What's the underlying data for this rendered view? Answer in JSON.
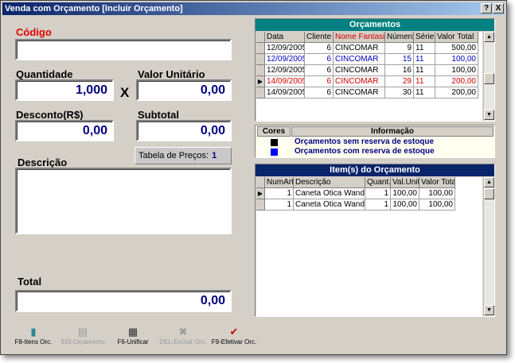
{
  "window": {
    "title": "Venda com Orçamento [Incluir Orçamento]",
    "help_btn": "?",
    "close_btn": "X"
  },
  "form": {
    "codigo_label": "Código",
    "codigo_value": "",
    "quantidade_label": "Quantidade",
    "quantidade_value": "1,000",
    "x_sign": "X",
    "valor_unitario_label": "Valor Unitário",
    "valor_unitario_value": "0,00",
    "desconto_label": "Desconto(R$)",
    "desconto_value": "0,00",
    "subtotal_label": "Subtotal",
    "subtotal_value": "0,00",
    "tabela_label": "Tabela de Preços:",
    "tabela_value": "1",
    "descricao_label": "Descrição",
    "descricao_value": "",
    "total_label": "Total",
    "total_value": "0,00"
  },
  "orcamentos": {
    "title": "Orçamentos",
    "columns": [
      "Data",
      "Cliente",
      "Nome Fantasia",
      "Número",
      "Série",
      "Valor Total"
    ],
    "rows": [
      {
        "data": "12/09/2005",
        "cliente": "6",
        "nome": "CINCOMAR",
        "numero": "9",
        "serie": "11",
        "valor": "500,00",
        "color": "#000000",
        "current": false
      },
      {
        "data": "12/09/2005",
        "cliente": "6",
        "nome": "CINCOMAR",
        "numero": "15",
        "serie": "11",
        "valor": "100,00",
        "color": "#0000c0",
        "current": false
      },
      {
        "data": "12/09/2005",
        "cliente": "6",
        "nome": "CINCOMAR",
        "numero": "16",
        "serie": "11",
        "valor": "100,00",
        "color": "#000000",
        "current": false
      },
      {
        "data": "14/09/2005",
        "cliente": "6",
        "nome": "CINCOMAR",
        "numero": "29",
        "serie": "11",
        "valor": "200,00",
        "color": "#d00000",
        "current": true
      },
      {
        "data": "14/09/2005",
        "cliente": "6",
        "nome": "CINCOMAR",
        "numero": "30",
        "serie": "11",
        "valor": "200,00",
        "color": "#000000",
        "current": false
      }
    ]
  },
  "legend": {
    "cores_label": "Cores",
    "informacao_label": "Informação",
    "items": [
      {
        "color": "#000000",
        "text": "Orçamentos sem reserva de estoque"
      },
      {
        "color": "#0000ff",
        "text": "Orçamentos com reserva de estoque"
      }
    ]
  },
  "itens": {
    "title": "Item(s) do Orçamento",
    "columns": [
      "NumArt",
      "Descrição",
      "Quant.",
      "Val.Unit.",
      "Valor Tota"
    ],
    "rows": [
      {
        "numart": "1",
        "descricao": "Caneta Otica Wand",
        "quant": "1",
        "valunit": "100,00",
        "total": "100,00",
        "current": true
      },
      {
        "numart": "1",
        "descricao": "Caneta Otica Wand",
        "quant": "1",
        "valunit": "100,00",
        "total": "100,00",
        "current": false
      }
    ]
  },
  "toolbar": [
    {
      "label": "F8-Itens Orc.",
      "icon": "document-icon",
      "glyph": "▮",
      "enabled": true,
      "color": "#2a8a8a"
    },
    {
      "label": "INS-Orçamento",
      "icon": "new-document-icon",
      "glyph": "▤",
      "enabled": false,
      "color": "#9a9a9a"
    },
    {
      "label": "F6-Unificar",
      "icon": "merge-icon",
      "glyph": "▦",
      "enabled": true,
      "color": "#303030"
    },
    {
      "label": "DEL-Excluir Orc.",
      "icon": "delete-icon",
      "glyph": "✖",
      "enabled": false,
      "color": "#9a9a9a"
    },
    {
      "label": "F9-Efetivar Orc.",
      "icon": "checkmark-icon",
      "glyph": "✔",
      "enabled": true,
      "color": "#d00000"
    }
  ]
}
